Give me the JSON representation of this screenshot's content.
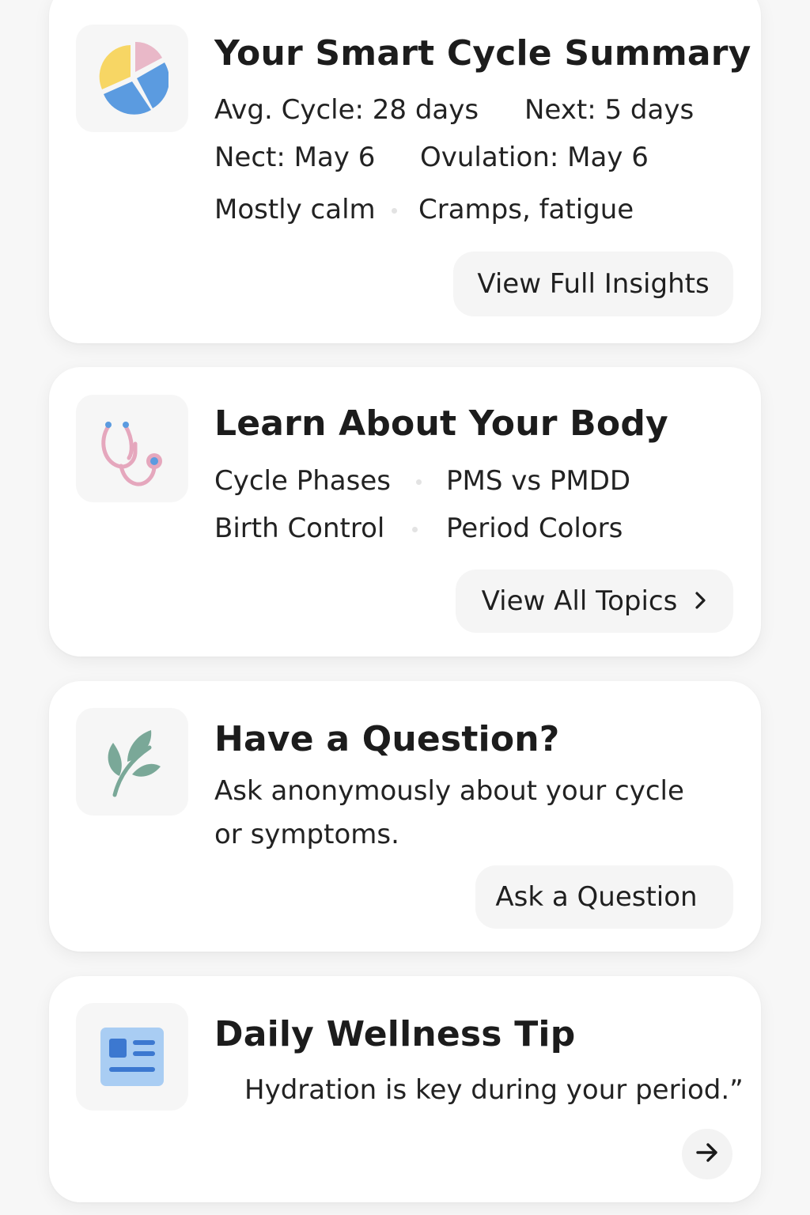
{
  "summary": {
    "icon": "pie-chart-icon",
    "title": "Your Smart Cycle Summary",
    "avg_cycle": "Avg. Cycle: 28 days",
    "next_in": "Next: 5 days",
    "next_date": "Nect: May 6",
    "ovulation": "Ovulation: May 6",
    "mood": "Mostly calm",
    "symptoms": "Cramps, fatigue",
    "button": "View Full Insights",
    "colors": {
      "yellow": "#f7d664",
      "pink": "#e9b8c8",
      "blue": "#5b9be0"
    }
  },
  "learn": {
    "icon": "stethoscope-icon",
    "title": "Learn About Your Body",
    "topics": [
      "Cycle Phases",
      "PMS vs PMDD",
      "Birth Control",
      "Period Colors"
    ],
    "button": "View All Topics",
    "button_icon": "chevron-right-icon",
    "colors": {
      "tube": "#e5a7bd",
      "accent": "#5b9be0"
    }
  },
  "question": {
    "icon": "leaf-icon",
    "title": "Have a Question?",
    "description_line1": "Ask anonymously about your cycle",
    "description_line2": "or symptoms.",
    "button": "Ask a Question",
    "colors": {
      "leaf": "#7aa898"
    }
  },
  "tip": {
    "icon": "article-icon",
    "title": "Daily Wellness Tip",
    "text": "Hydration is key during your period.”",
    "button_icon": "arrow-right-icon",
    "colors": {
      "panel": "#a9cdf3",
      "ink": "#3c78d0"
    }
  }
}
